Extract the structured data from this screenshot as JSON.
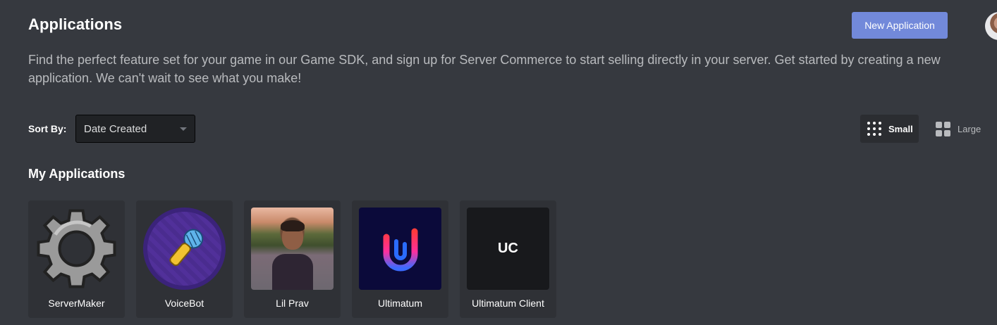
{
  "header": {
    "title": "Applications",
    "new_app_label": "New Application",
    "description": "Find the perfect feature set for your game in our Game SDK, and sign up for Server Commerce to start selling directly in your server. Get started by creating a new application. We can't wait to see what you make!"
  },
  "sort": {
    "label": "Sort By:",
    "selected": "Date Created"
  },
  "view_toggle": {
    "small_label": "Small",
    "large_label": "Large",
    "active": "small"
  },
  "section": {
    "title": "My Applications"
  },
  "apps": [
    {
      "name": "ServerMaker",
      "icon": "gear-icon"
    },
    {
      "name": "VoiceBot",
      "icon": "microphone-icon"
    },
    {
      "name": "Lil Prav",
      "icon": "photo"
    },
    {
      "name": "Ultimatum",
      "icon": "u-logo"
    },
    {
      "name": "Ultimatum Client",
      "icon_text": "UC"
    }
  ],
  "colors": {
    "background": "#36393f",
    "card": "#2f3136",
    "accent": "#7289da"
  }
}
